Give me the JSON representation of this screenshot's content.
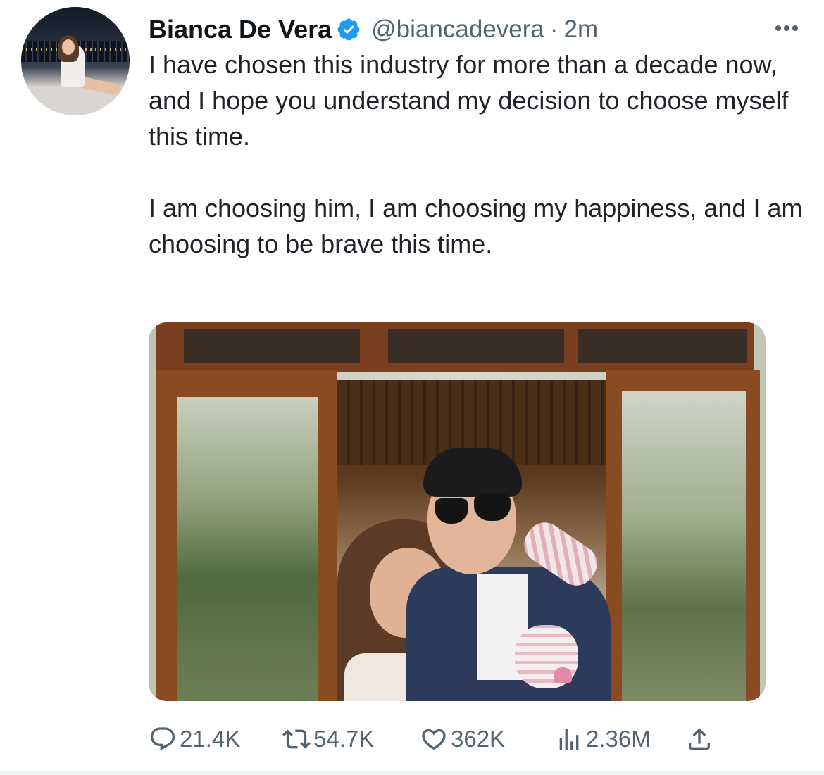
{
  "tweet": {
    "author_name": "Bianca De Vera",
    "handle": "@biancadevera",
    "separator": "·",
    "timestamp": "2m",
    "paragraph_1": "I have chosen this industry for more than a decade now, and I hope you understand my decision to choose myself this time.",
    "paragraph_2": "I am choosing him, I am choosing my happiness, and I am choosing to be brave this time."
  },
  "metrics": {
    "replies": "21.4K",
    "retweets": "54.7K",
    "likes": "362K",
    "views": "2.36M"
  },
  "colors": {
    "verified": "#1d9bf0",
    "secondary_text": "#536471",
    "primary_text": "#0f1419"
  },
  "icons": [
    "verified-badge-icon",
    "more-options-icon",
    "reply-icon",
    "retweet-icon",
    "like-icon",
    "views-icon",
    "share-icon"
  ]
}
